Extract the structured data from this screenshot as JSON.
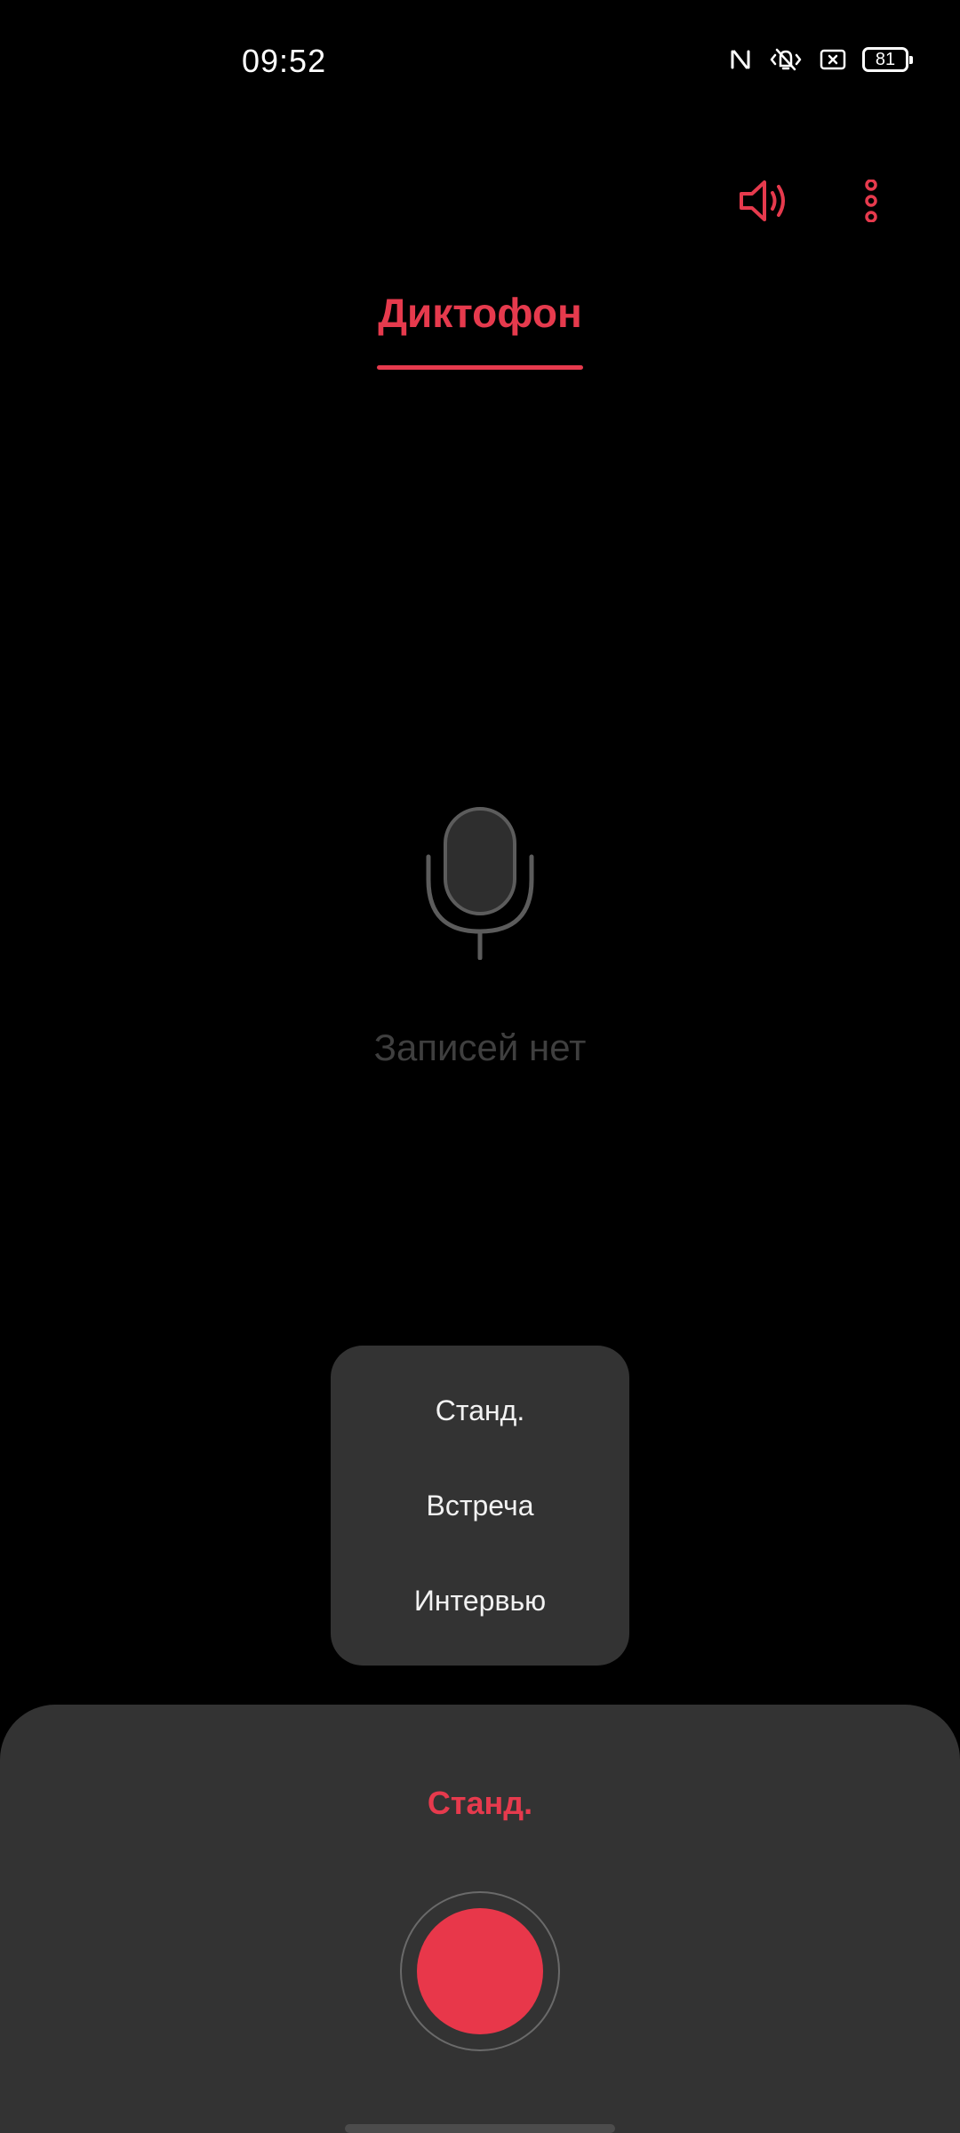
{
  "status_bar": {
    "time": "09:52",
    "battery_level": "81",
    "icons": [
      "nfc-icon",
      "vibrate-icon",
      "battery-saver-icon",
      "battery-icon"
    ]
  },
  "toolbar": {
    "icons": [
      "speaker-icon",
      "more-vertical-icon"
    ]
  },
  "tab": {
    "label": "Диктофон"
  },
  "empty_state": {
    "icon": "microphone-icon",
    "message": "Записей нет"
  },
  "mode_menu": {
    "options": [
      "Станд.",
      "Встреча",
      "Интервью"
    ]
  },
  "recorder": {
    "current_mode": "Станд."
  },
  "colors": {
    "accent": "#e63a4d",
    "record_button": "#e8374a",
    "panel_background": "#333333",
    "app_background": "#000000",
    "muted_text": "#3f3f3f"
  }
}
